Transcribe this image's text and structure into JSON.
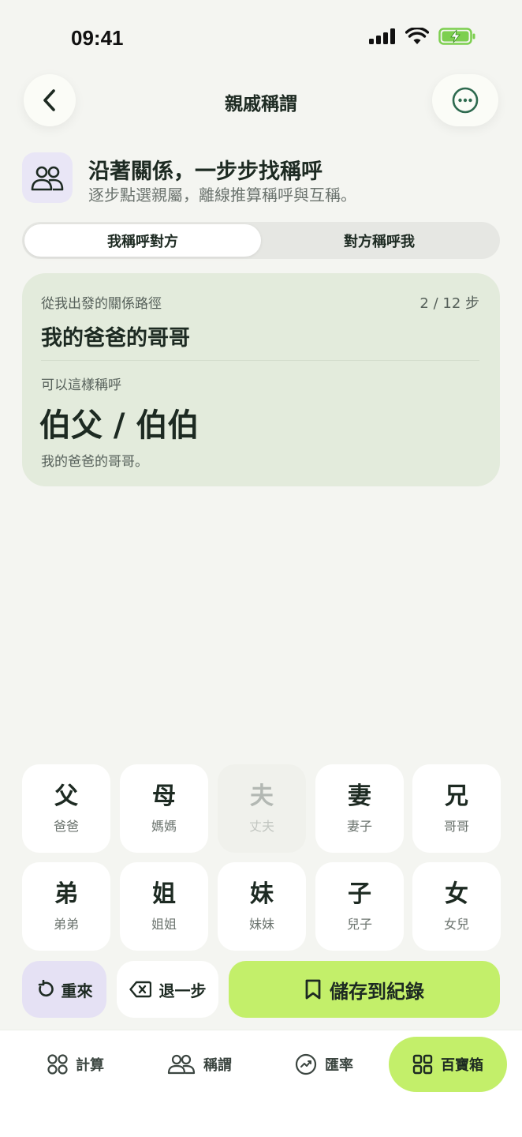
{
  "status": {
    "time": "09:41"
  },
  "nav": {
    "title": "親戚稱謂"
  },
  "intro": {
    "title": "沿著關係，一步步找稱呼",
    "subtitle": "逐步點選親屬，離線推算稱呼與互稱。"
  },
  "segment": {
    "options": [
      "我稱呼對方",
      "對方稱呼我"
    ],
    "selected": "我稱呼對方"
  },
  "result": {
    "path_label": "從我出發的關係路徑",
    "step": "2 / 12 步",
    "path": "我的爸爸的哥哥",
    "answer_label": "可以這樣稱呼",
    "answer": "伯父 / 伯伯",
    "note": "我的爸爸的哥哥。"
  },
  "keys": [
    {
      "char": "父",
      "label": "爸爸",
      "enabled": true
    },
    {
      "char": "母",
      "label": "媽媽",
      "enabled": true
    },
    {
      "char": "夫",
      "label": "丈夫",
      "enabled": false
    },
    {
      "char": "妻",
      "label": "妻子",
      "enabled": true
    },
    {
      "char": "兄",
      "label": "哥哥",
      "enabled": true
    },
    {
      "char": "弟",
      "label": "弟弟",
      "enabled": true
    },
    {
      "char": "姐",
      "label": "姐姐",
      "enabled": true
    },
    {
      "char": "妹",
      "label": "妹妹",
      "enabled": true
    },
    {
      "char": "子",
      "label": "兒子",
      "enabled": true
    },
    {
      "char": "女",
      "label": "女兒",
      "enabled": true
    }
  ],
  "actions": {
    "reset": "重來",
    "undo": "退一步",
    "save": "儲存到紀錄"
  },
  "tabs": [
    {
      "label": "計算",
      "icon": "grid-circles-icon"
    },
    {
      "label": "稱謂",
      "icon": "people-icon"
    },
    {
      "label": "匯率",
      "icon": "currency-icon"
    },
    {
      "label": "百寶箱",
      "icon": "grid-squares-icon",
      "active": true
    }
  ],
  "colors": {
    "accent": "#c3ef6a",
    "card": "#e3ebdc",
    "lavender": "#e5e1f4",
    "text": "#1d2a22"
  }
}
